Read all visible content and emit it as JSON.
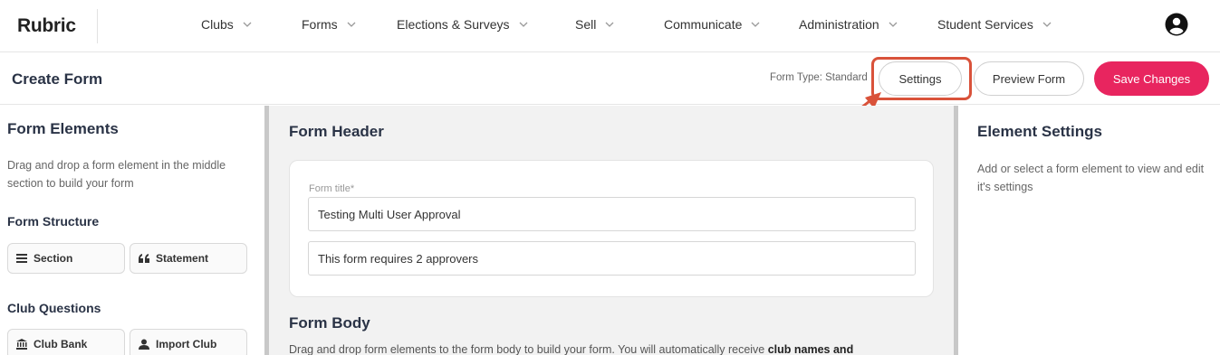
{
  "nav": {
    "logo": "Rubric",
    "items": [
      {
        "label": "Clubs"
      },
      {
        "label": "Forms"
      },
      {
        "label": "Elections & Surveys"
      },
      {
        "label": "Sell"
      },
      {
        "label": "Communicate"
      },
      {
        "label": "Administration"
      },
      {
        "label": "Student Services"
      }
    ],
    "avatar_icon": "user-circle-icon"
  },
  "header": {
    "title": "Create Form",
    "form_type": "Form Type: Standard",
    "settings_label": "Settings",
    "preview_label": "Preview Form",
    "save_label": "Save Changes",
    "save_color": "#e8255f",
    "highlight_color": "#d9523a"
  },
  "left": {
    "title": "Form Elements",
    "description": "Drag and drop a form element in the middle section to build your form",
    "structure_title": "Form Structure",
    "structure_items": [
      {
        "label": "Section",
        "icon": "list-icon"
      },
      {
        "label": "Statement",
        "icon": "quote-icon"
      }
    ],
    "club_title": "Club Questions",
    "club_items": [
      {
        "label": "Club Bank",
        "icon": "bank-icon"
      },
      {
        "label": "Import Club",
        "icon": "person-icon"
      }
    ]
  },
  "middle": {
    "header_title": "Form Header",
    "title_label": "Form title*",
    "title_value": "Testing Multi User Approval",
    "description_value": "This form requires 2 approvers",
    "body_title": "Form Body",
    "body_text": "Drag and drop form elements to the form body to build your form. You will automatically receive ",
    "body_bold": "club names and"
  },
  "right": {
    "title": "Element Settings",
    "description": "Add or select a form element to view and edit it's settings"
  }
}
